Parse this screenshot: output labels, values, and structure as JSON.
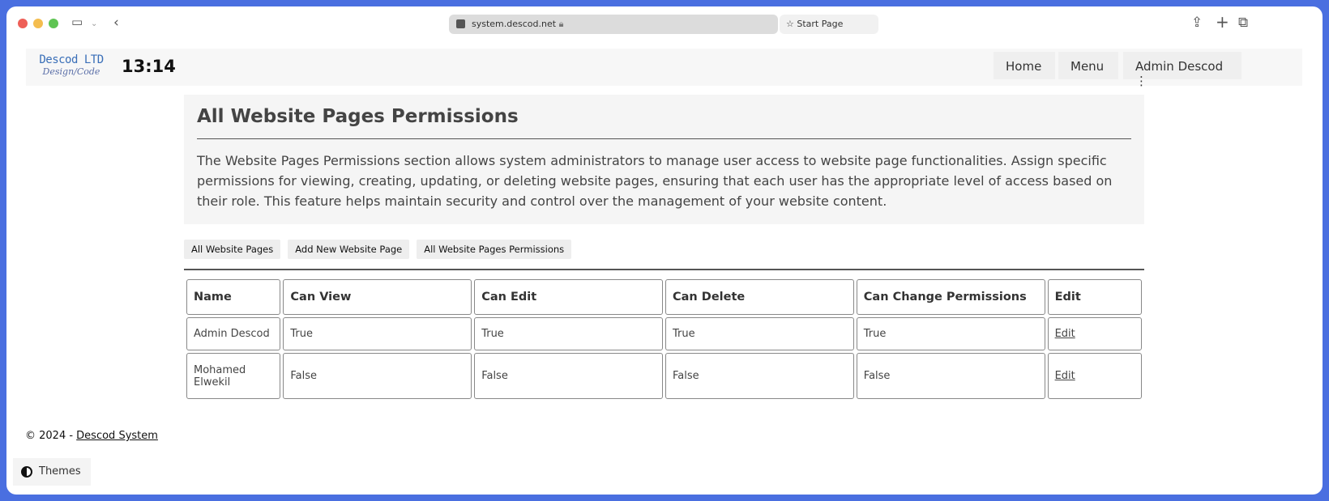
{
  "browser": {
    "url": "system.descod.net",
    "tab": "Start Page"
  },
  "nav": {
    "logo_line1": "Descod LTD",
    "logo_line2": "Design/Code",
    "clock": "13:14",
    "home": "Home",
    "menu": "Menu",
    "user": "Admin Descod"
  },
  "header": {
    "title": "All Website Pages Permissions",
    "description": "The Website Pages Permissions section allows system administrators to manage user access to website page functionalities. Assign specific permissions for viewing, creating, updating, or deleting website pages, ensuring that each user has the appropriate level of access based on their role. This feature helps maintain security and control over the management of your website content."
  },
  "actions": [
    "All Website Pages",
    "Add New Website Page",
    "All Website Pages Permissions"
  ],
  "table": {
    "columns": [
      "Name",
      "Can View",
      "Can Edit",
      "Can Delete",
      "Can Change Permissions",
      "Edit"
    ],
    "rows": [
      [
        "Admin Descod",
        "True",
        "True",
        "True",
        "True",
        "Edit"
      ],
      [
        "Mohamed Elwekil",
        "False",
        "False",
        "False",
        "False",
        "Edit"
      ]
    ]
  },
  "footer": {
    "prefix": "© 2024 - ",
    "link": "Descod System"
  },
  "themes": "Themes"
}
